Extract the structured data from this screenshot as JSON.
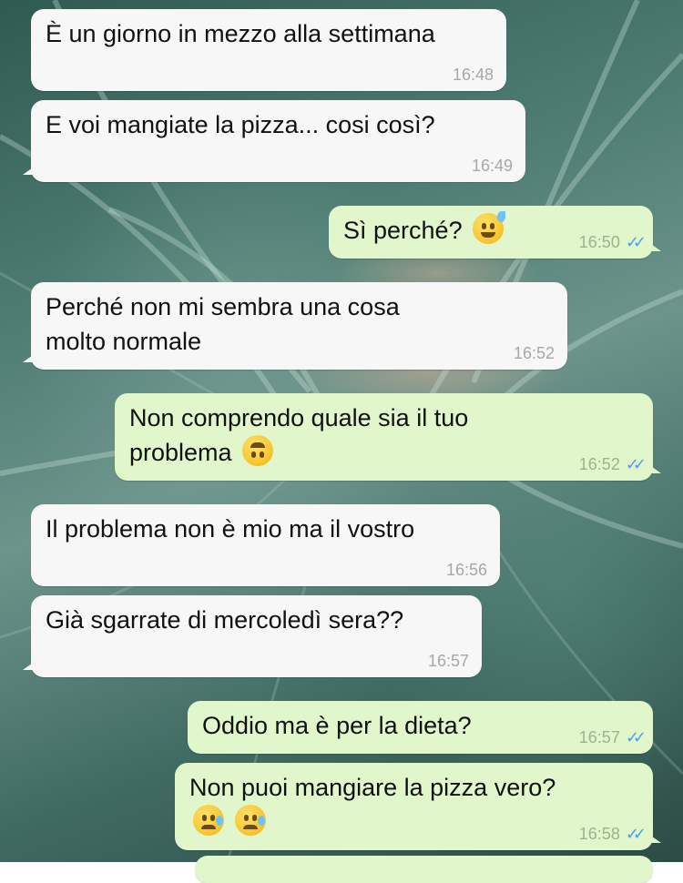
{
  "messages": [
    {
      "text": "È un giorno in mezzo alla settimana",
      "time": "16:48",
      "direction": "in"
    },
    {
      "text": "E voi mangiate la pizza... cosi così?",
      "time": "16:49",
      "direction": "in"
    },
    {
      "text": "Sì perché?",
      "time": "16:50",
      "direction": "out",
      "emoji": "grinning-sweat-emoji",
      "read": "✓✓"
    },
    {
      "text_line1": "Perché non mi sembra una cosa",
      "text_line2": "molto normale",
      "time": "16:52",
      "direction": "in"
    },
    {
      "text_line1": "Non comprendo quale sia il tuo",
      "text_line2": "problema",
      "time": "16:52",
      "direction": "out",
      "emoji": "upside-down-face-emoji",
      "read": "✓✓"
    },
    {
      "text": "Il problema non è mio ma il vostro",
      "time": "16:56",
      "direction": "in"
    },
    {
      "text": "Già sgarrate di mercoledì sera??",
      "time": "16:57",
      "direction": "in"
    },
    {
      "text": "Oddio ma è per la dieta?",
      "time": "16:57",
      "direction": "out",
      "read": "✓✓"
    },
    {
      "text": "Non puoi mangiare la pizza vero?",
      "time": "16:58",
      "direction": "out",
      "emoji": "sad-relieved-face-emoji",
      "read": "✓✓"
    }
  ],
  "colors": {
    "incoming_bubble": "#f7f7f7",
    "outgoing_bubble": "#e1f7cb",
    "read_ticks": "#4f9ee6",
    "timestamp": "#a7a7a7"
  }
}
